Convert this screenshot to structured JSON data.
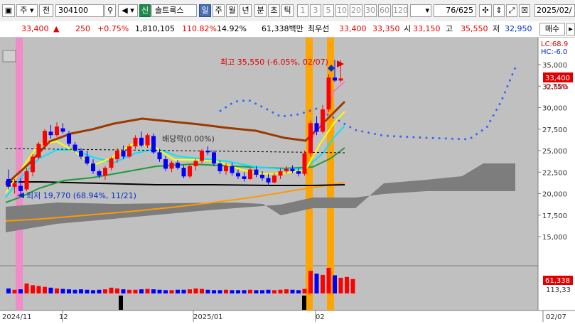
{
  "toolbar": {
    "market_select": "주",
    "period_label": "전",
    "stock_code": "304100",
    "stock_badge": "신",
    "stock_name": "솔트룩스",
    "interval_tabs": [
      "일",
      "주",
      "월",
      "년",
      "분",
      "초",
      "틱"
    ],
    "active_tab": "일",
    "num_tabs": [
      "1",
      "3",
      "5",
      "10",
      "20",
      "30",
      "60",
      "120"
    ],
    "count_value": "76",
    "count_total": "/625",
    "date_field": "2025/02/"
  },
  "quote": {
    "price": "33,400",
    "change_arrow": "▲",
    "change": "250",
    "change_pct": "+0.75%",
    "volume": "1,810,105",
    "vol_ratio": "110.82%",
    "turnover": "14.92%",
    "trade_value": "61,338백만",
    "priority_label": "최우선",
    "ask": "33,400",
    "bid": "33,350",
    "open_label": "시",
    "open": "33,150",
    "high_label": "고",
    "high": "35,550",
    "low_label": "저",
    "low": "32,950",
    "buy_button": "매수"
  },
  "chart": {
    "high_annotation": "최고 35,550 (-6.05%, 02/07)",
    "low_annotation": "최저 19,770 (68.94%, 11/21)",
    "dividend_annotation": "배당락(0.00%)",
    "lc_label": "LC:68.9",
    "hc_label": "HC:-6.0",
    "price_tag": "33,400",
    "pct_tag": "0.75%",
    "vol_tag": "61,338",
    "vol_tag2": "113,33"
  },
  "chart_data": {
    "type": "candlestick",
    "y_ticks": [
      "35,000",
      "32,500",
      "30,000",
      "27,500",
      "25,000",
      "22,500",
      "20,000",
      "17,500",
      "15,000"
    ],
    "ylim": [
      15000,
      36000
    ],
    "x_labels": [
      "2024/11",
      "12",
      "2025/01",
      "02",
      "02/07"
    ],
    "candles": [
      {
        "o": 21700,
        "h": 22800,
        "l": 20500,
        "c": 20800
      },
      {
        "o": 20800,
        "h": 21700,
        "l": 20000,
        "c": 21200
      },
      {
        "o": 20900,
        "h": 21800,
        "l": 19770,
        "c": 20300
      },
      {
        "o": 20500,
        "h": 23000,
        "l": 20300,
        "c": 22600
      },
      {
        "o": 22500,
        "h": 24600,
        "l": 22000,
        "c": 24300
      },
      {
        "o": 24200,
        "h": 26000,
        "l": 24000,
        "c": 25800
      },
      {
        "o": 25600,
        "h": 27500,
        "l": 25300,
        "c": 27300
      },
      {
        "o": 27200,
        "h": 28000,
        "l": 26400,
        "c": 26800
      },
      {
        "o": 26800,
        "h": 28300,
        "l": 26600,
        "c": 27800
      },
      {
        "o": 27600,
        "h": 28200,
        "l": 27000,
        "c": 27200
      },
      {
        "o": 27000,
        "h": 27300,
        "l": 25500,
        "c": 25800
      },
      {
        "o": 25700,
        "h": 26000,
        "l": 24800,
        "c": 25000
      },
      {
        "o": 25000,
        "h": 25300,
        "l": 24000,
        "c": 24300
      },
      {
        "o": 24300,
        "h": 25000,
        "l": 23300,
        "c": 23500
      },
      {
        "o": 23500,
        "h": 24000,
        "l": 22300,
        "c": 22600
      },
      {
        "o": 22600,
        "h": 22800,
        "l": 21800,
        "c": 22100
      },
      {
        "o": 22100,
        "h": 23200,
        "l": 21600,
        "c": 23000
      },
      {
        "o": 23000,
        "h": 24300,
        "l": 22700,
        "c": 24100
      },
      {
        "o": 24000,
        "h": 25300,
        "l": 23600,
        "c": 25000
      },
      {
        "o": 25000,
        "h": 25600,
        "l": 24000,
        "c": 24300
      },
      {
        "o": 24300,
        "h": 25800,
        "l": 24100,
        "c": 25500
      },
      {
        "o": 25500,
        "h": 26800,
        "l": 25200,
        "c": 26500
      },
      {
        "o": 26500,
        "h": 27200,
        "l": 25400,
        "c": 25600
      },
      {
        "o": 25600,
        "h": 27000,
        "l": 25300,
        "c": 26800
      },
      {
        "o": 26700,
        "h": 27000,
        "l": 24600,
        "c": 24800
      },
      {
        "o": 24800,
        "h": 25200,
        "l": 23700,
        "c": 24000
      },
      {
        "o": 24000,
        "h": 24400,
        "l": 22600,
        "c": 22900
      },
      {
        "o": 22900,
        "h": 23800,
        "l": 22500,
        "c": 23600
      },
      {
        "o": 23600,
        "h": 23900,
        "l": 22800,
        "c": 23000
      },
      {
        "o": 23000,
        "h": 23300,
        "l": 21800,
        "c": 22000
      },
      {
        "o": 22000,
        "h": 23400,
        "l": 21800,
        "c": 23200
      },
      {
        "o": 23200,
        "h": 24000,
        "l": 22700,
        "c": 23800
      },
      {
        "o": 23800,
        "h": 25200,
        "l": 23500,
        "c": 25000
      },
      {
        "o": 25000,
        "h": 25500,
        "l": 24500,
        "c": 24800
      },
      {
        "o": 24800,
        "h": 25000,
        "l": 23200,
        "c": 23500
      },
      {
        "o": 23500,
        "h": 23800,
        "l": 22300,
        "c": 22600
      },
      {
        "o": 22600,
        "h": 23500,
        "l": 22200,
        "c": 23200
      },
      {
        "o": 23200,
        "h": 23600,
        "l": 22100,
        "c": 22400
      },
      {
        "o": 22400,
        "h": 22800,
        "l": 21700,
        "c": 22000
      },
      {
        "o": 22000,
        "h": 22500,
        "l": 21400,
        "c": 21700
      },
      {
        "o": 21700,
        "h": 23000,
        "l": 21600,
        "c": 22800
      },
      {
        "o": 22800,
        "h": 23200,
        "l": 21900,
        "c": 22200
      },
      {
        "o": 22200,
        "h": 22600,
        "l": 21500,
        "c": 21800
      },
      {
        "o": 21800,
        "h": 22300,
        "l": 21000,
        "c": 21300
      },
      {
        "o": 21300,
        "h": 22400,
        "l": 21200,
        "c": 22100
      },
      {
        "o": 22100,
        "h": 23000,
        "l": 21700,
        "c": 22600
      },
      {
        "o": 22600,
        "h": 23200,
        "l": 22300,
        "c": 22900
      },
      {
        "o": 22900,
        "h": 23300,
        "l": 22400,
        "c": 22600
      },
      {
        "o": 22600,
        "h": 23000,
        "l": 22000,
        "c": 22300
      },
      {
        "o": 22300,
        "h": 25000,
        "l": 22100,
        "c": 24700
      },
      {
        "o": 24700,
        "h": 28500,
        "l": 24300,
        "c": 28200
      },
      {
        "o": 28200,
        "h": 29000,
        "l": 26800,
        "c": 27200
      },
      {
        "o": 27200,
        "h": 30300,
        "l": 27000,
        "c": 29800
      },
      {
        "o": 29800,
        "h": 33900,
        "l": 29500,
        "c": 33500
      },
      {
        "o": 33500,
        "h": 35550,
        "l": 33000,
        "c": 33150
      },
      {
        "o": 33150,
        "h": 35550,
        "l": 32950,
        "c": 33400
      }
    ],
    "volumes": [
      12,
      9,
      10,
      24,
      20,
      18,
      16,
      14,
      12,
      11,
      10,
      9,
      10,
      9,
      8,
      9,
      10,
      14,
      12,
      10,
      9,
      9,
      10,
      11,
      10,
      9,
      8,
      8,
      9,
      9,
      10,
      12,
      11,
      9,
      8,
      8,
      9,
      8,
      8,
      8,
      9,
      8,
      8,
      9,
      8,
      9,
      10,
      9,
      8,
      11,
      55,
      48,
      45,
      62,
      44,
      38,
      40,
      35
    ]
  }
}
